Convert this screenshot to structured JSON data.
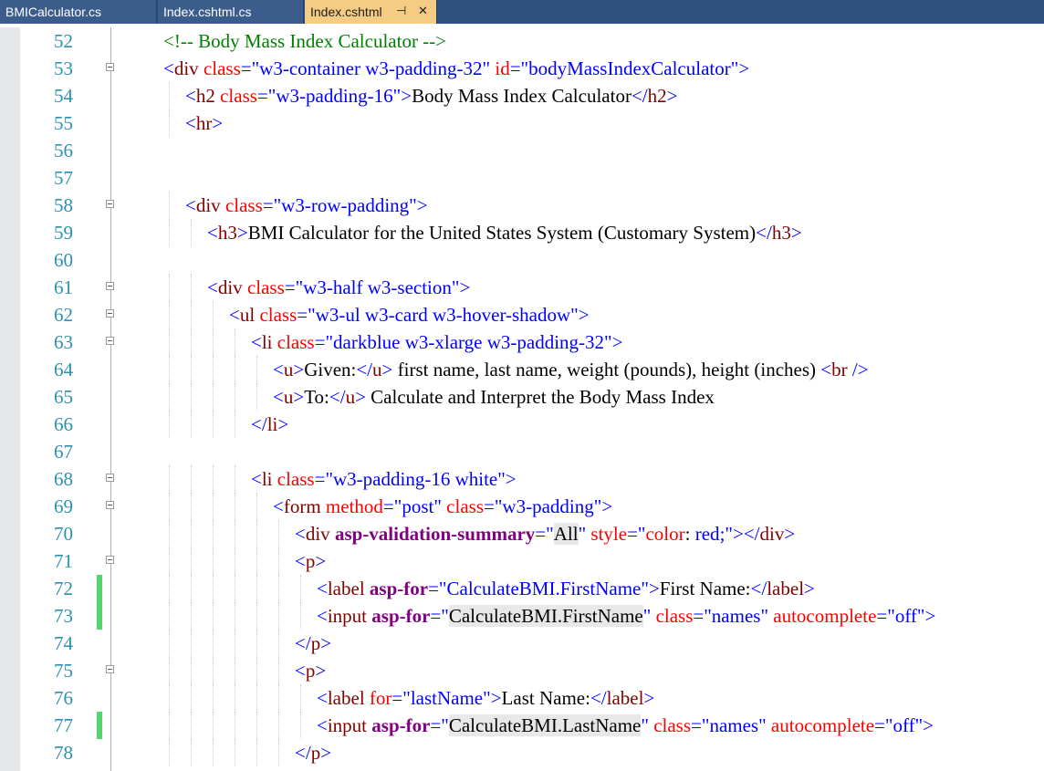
{
  "tabs": [
    {
      "label": "BMICalculator.cs",
      "active": false
    },
    {
      "label": "Index.cshtml.cs",
      "active": false
    },
    {
      "label": "Index.cshtml",
      "active": true
    }
  ],
  "tab_icons": {
    "pin": "pin-icon",
    "close": "close-icon"
  },
  "colors": {
    "tab_bar": "#2f4f7f",
    "active_tab": "#f5cc84",
    "line_number": "#2b91af",
    "change_marker": "#57d36f"
  },
  "lines": [
    {
      "num": "52",
      "fold": false,
      "changed": false,
      "indent": 0,
      "segments": [
        {
          "t": "<!-- Body Mass Index Calculator -->",
          "c": "c"
        }
      ]
    },
    {
      "num": "53",
      "fold": true,
      "changed": false,
      "indent": 0,
      "segments": [
        {
          "t": "<",
          "c": "b"
        },
        {
          "t": "div",
          "c": "t"
        },
        {
          "t": " "
        },
        {
          "t": "class",
          "c": "a"
        },
        {
          "t": "=",
          "c": "b"
        },
        {
          "t": "\"w3-container w3-padding-32\"",
          "c": "v"
        },
        {
          "t": " "
        },
        {
          "t": "id",
          "c": "a"
        },
        {
          "t": "=",
          "c": "b"
        },
        {
          "t": "\"bodyMassIndexCalculator\"",
          "c": "v"
        },
        {
          "t": ">",
          "c": "b"
        }
      ]
    },
    {
      "num": "54",
      "fold": false,
      "changed": false,
      "indent": 1,
      "segments": [
        {
          "t": "<",
          "c": "b"
        },
        {
          "t": "h2",
          "c": "t"
        },
        {
          "t": " "
        },
        {
          "t": "class",
          "c": "a"
        },
        {
          "t": "=",
          "c": "b"
        },
        {
          "t": "\"w3-padding-16\"",
          "c": "v"
        },
        {
          "t": ">",
          "c": "b"
        },
        {
          "t": "Body Mass Index Calculator"
        },
        {
          "t": "</",
          "c": "b"
        },
        {
          "t": "h2",
          "c": "t"
        },
        {
          "t": ">",
          "c": "b"
        }
      ]
    },
    {
      "num": "55",
      "fold": false,
      "changed": false,
      "indent": 1,
      "segments": [
        {
          "t": "<",
          "c": "b"
        },
        {
          "t": "hr",
          "c": "t"
        },
        {
          "t": ">",
          "c": "b"
        }
      ]
    },
    {
      "num": "56",
      "fold": false,
      "changed": false,
      "indent": 0,
      "segments": []
    },
    {
      "num": "57",
      "fold": false,
      "changed": false,
      "indent": 0,
      "segments": []
    },
    {
      "num": "58",
      "fold": true,
      "changed": false,
      "indent": 1,
      "segments": [
        {
          "t": "<",
          "c": "b"
        },
        {
          "t": "div",
          "c": "t"
        },
        {
          "t": " "
        },
        {
          "t": "class",
          "c": "a"
        },
        {
          "t": "=",
          "c": "b"
        },
        {
          "t": "\"w3-row-padding\"",
          "c": "v"
        },
        {
          "t": ">",
          "c": "b"
        }
      ]
    },
    {
      "num": "59",
      "fold": false,
      "changed": false,
      "indent": 2,
      "segments": [
        {
          "t": "<",
          "c": "b"
        },
        {
          "t": "h3",
          "c": "t"
        },
        {
          "t": ">",
          "c": "b"
        },
        {
          "t": "BMI Calculator for the United States System (Customary System)"
        },
        {
          "t": "</",
          "c": "b"
        },
        {
          "t": "h3",
          "c": "t"
        },
        {
          "t": ">",
          "c": "b"
        }
      ]
    },
    {
      "num": "60",
      "fold": false,
      "changed": false,
      "indent": 0,
      "segments": []
    },
    {
      "num": "61",
      "fold": true,
      "changed": false,
      "indent": 2,
      "segments": [
        {
          "t": "<",
          "c": "b"
        },
        {
          "t": "div",
          "c": "t"
        },
        {
          "t": " "
        },
        {
          "t": "class",
          "c": "a"
        },
        {
          "t": "=",
          "c": "b"
        },
        {
          "t": "\"w3-half w3-section\"",
          "c": "v"
        },
        {
          "t": ">",
          "c": "b"
        }
      ]
    },
    {
      "num": "62",
      "fold": true,
      "changed": false,
      "indent": 3,
      "segments": [
        {
          "t": "<",
          "c": "b"
        },
        {
          "t": "ul",
          "c": "t"
        },
        {
          "t": " "
        },
        {
          "t": "class",
          "c": "a"
        },
        {
          "t": "=",
          "c": "b"
        },
        {
          "t": "\"w3-ul w3-card w3-hover-shadow\"",
          "c": "v"
        },
        {
          "t": ">",
          "c": "b"
        }
      ]
    },
    {
      "num": "63",
      "fold": true,
      "changed": false,
      "indent": 4,
      "segments": [
        {
          "t": "<",
          "c": "b"
        },
        {
          "t": "li",
          "c": "t"
        },
        {
          "t": " "
        },
        {
          "t": "class",
          "c": "a"
        },
        {
          "t": "=",
          "c": "b"
        },
        {
          "t": "\"darkblue w3-xlarge w3-padding-32\"",
          "c": "v"
        },
        {
          "t": ">",
          "c": "b"
        }
      ]
    },
    {
      "num": "64",
      "fold": false,
      "changed": false,
      "indent": 5,
      "segments": [
        {
          "t": "<",
          "c": "b"
        },
        {
          "t": "u",
          "c": "t"
        },
        {
          "t": ">",
          "c": "b"
        },
        {
          "t": "Given:"
        },
        {
          "t": "</",
          "c": "b"
        },
        {
          "t": "u",
          "c": "t"
        },
        {
          "t": ">",
          "c": "b"
        },
        {
          "t": " first name, last name, weight (pounds), height (inches) "
        },
        {
          "t": "<",
          "c": "b"
        },
        {
          "t": "br",
          "c": "t"
        },
        {
          "t": " />",
          "c": "b"
        }
      ]
    },
    {
      "num": "65",
      "fold": false,
      "changed": false,
      "indent": 5,
      "segments": [
        {
          "t": "<",
          "c": "b"
        },
        {
          "t": "u",
          "c": "t"
        },
        {
          "t": ">",
          "c": "b"
        },
        {
          "t": "To:"
        },
        {
          "t": "</",
          "c": "b"
        },
        {
          "t": "u",
          "c": "t"
        },
        {
          "t": ">",
          "c": "b"
        },
        {
          "t": " Calculate and Interpret the Body Mass Index"
        }
      ]
    },
    {
      "num": "66",
      "fold": false,
      "changed": false,
      "indent": 4,
      "segments": [
        {
          "t": "</",
          "c": "b"
        },
        {
          "t": "li",
          "c": "t"
        },
        {
          "t": ">",
          "c": "b"
        }
      ]
    },
    {
      "num": "67",
      "fold": false,
      "changed": false,
      "indent": 0,
      "segments": []
    },
    {
      "num": "68",
      "fold": true,
      "changed": false,
      "indent": 4,
      "segments": [
        {
          "t": "<",
          "c": "b"
        },
        {
          "t": "li",
          "c": "t"
        },
        {
          "t": " "
        },
        {
          "t": "class",
          "c": "a"
        },
        {
          "t": "=",
          "c": "b"
        },
        {
          "t": "\"w3-padding-16 white\"",
          "c": "v"
        },
        {
          "t": ">",
          "c": "b"
        }
      ]
    },
    {
      "num": "69",
      "fold": true,
      "changed": false,
      "indent": 5,
      "segments": [
        {
          "t": "<",
          "c": "b"
        },
        {
          "t": "form",
          "c": "t"
        },
        {
          "t": " "
        },
        {
          "t": "method",
          "c": "a"
        },
        {
          "t": "=",
          "c": "b"
        },
        {
          "t": "\"post\"",
          "c": "v"
        },
        {
          "t": " "
        },
        {
          "t": "class",
          "c": "a"
        },
        {
          "t": "=",
          "c": "b"
        },
        {
          "t": "\"w3-padding\"",
          "c": "v"
        },
        {
          "t": ">",
          "c": "b"
        }
      ]
    },
    {
      "num": "70",
      "fold": false,
      "changed": false,
      "indent": 6,
      "segments": [
        {
          "t": "<",
          "c": "b"
        },
        {
          "t": "div",
          "c": "t"
        },
        {
          "t": " "
        },
        {
          "t": "asp-validation-summary",
          "c": "k"
        },
        {
          "t": "=",
          "c": "b"
        },
        {
          "t": "\"",
          "c": "v"
        },
        {
          "t": "All",
          "c": "hl"
        },
        {
          "t": "\"",
          "c": "v"
        },
        {
          "t": " "
        },
        {
          "t": "style",
          "c": "a"
        },
        {
          "t": "=",
          "c": "b"
        },
        {
          "t": "\"",
          "c": "v"
        },
        {
          "t": "color",
          "c": "a"
        },
        {
          "t": ": "
        },
        {
          "t": "red",
          "c": "v"
        },
        {
          "t": ";\"",
          "c": "v"
        },
        {
          "t": "></",
          "c": "b"
        },
        {
          "t": "div",
          "c": "t"
        },
        {
          "t": ">",
          "c": "b"
        }
      ]
    },
    {
      "num": "71",
      "fold": true,
      "changed": false,
      "indent": 6,
      "segments": [
        {
          "t": "<",
          "c": "b"
        },
        {
          "t": "p",
          "c": "t"
        },
        {
          "t": ">",
          "c": "b"
        }
      ]
    },
    {
      "num": "72",
      "fold": false,
      "changed": true,
      "indent": 7,
      "segments": [
        {
          "t": "<",
          "c": "b"
        },
        {
          "t": "label",
          "c": "t"
        },
        {
          "t": " "
        },
        {
          "t": "asp-for",
          "c": "k"
        },
        {
          "t": "=",
          "c": "b"
        },
        {
          "t": "\"CalculateBMI.FirstName\"",
          "c": "v"
        },
        {
          "t": ">",
          "c": "b"
        },
        {
          "t": "First Name:"
        },
        {
          "t": "</",
          "c": "b"
        },
        {
          "t": "label",
          "c": "t"
        },
        {
          "t": ">",
          "c": "b"
        }
      ]
    },
    {
      "num": "73",
      "fold": false,
      "changed": true,
      "indent": 7,
      "segments": [
        {
          "t": "<",
          "c": "b"
        },
        {
          "t": "input",
          "c": "t"
        },
        {
          "t": " "
        },
        {
          "t": "asp-for",
          "c": "k"
        },
        {
          "t": "=",
          "c": "b"
        },
        {
          "t": "\"",
          "c": "v"
        },
        {
          "t": "CalculateBMI.FirstName",
          "c": "hl"
        },
        {
          "t": "\"",
          "c": "v"
        },
        {
          "t": " "
        },
        {
          "t": "class",
          "c": "a"
        },
        {
          "t": "=",
          "c": "b"
        },
        {
          "t": "\"names\"",
          "c": "v"
        },
        {
          "t": " "
        },
        {
          "t": "autocomplete",
          "c": "a"
        },
        {
          "t": "=",
          "c": "b"
        },
        {
          "t": "\"off\"",
          "c": "v"
        },
        {
          "t": ">",
          "c": "b"
        }
      ]
    },
    {
      "num": "74",
      "fold": false,
      "changed": false,
      "indent": 6,
      "segments": [
        {
          "t": "</",
          "c": "b"
        },
        {
          "t": "p",
          "c": "t"
        },
        {
          "t": ">",
          "c": "b"
        }
      ]
    },
    {
      "num": "75",
      "fold": true,
      "changed": false,
      "indent": 6,
      "segments": [
        {
          "t": "<",
          "c": "b"
        },
        {
          "t": "p",
          "c": "t"
        },
        {
          "t": ">",
          "c": "b"
        }
      ]
    },
    {
      "num": "76",
      "fold": false,
      "changed": false,
      "indent": 7,
      "segments": [
        {
          "t": "<",
          "c": "b"
        },
        {
          "t": "label",
          "c": "t"
        },
        {
          "t": " "
        },
        {
          "t": "for",
          "c": "a"
        },
        {
          "t": "=",
          "c": "b"
        },
        {
          "t": "\"lastName\"",
          "c": "v"
        },
        {
          "t": ">",
          "c": "b"
        },
        {
          "t": "Last Name:"
        },
        {
          "t": "</",
          "c": "b"
        },
        {
          "t": "label",
          "c": "t"
        },
        {
          "t": ">",
          "c": "b"
        }
      ]
    },
    {
      "num": "77",
      "fold": false,
      "changed": true,
      "indent": 7,
      "segments": [
        {
          "t": "<",
          "c": "b"
        },
        {
          "t": "input",
          "c": "t"
        },
        {
          "t": " "
        },
        {
          "t": "asp-for",
          "c": "k"
        },
        {
          "t": "=",
          "c": "b"
        },
        {
          "t": "\"",
          "c": "v"
        },
        {
          "t": "CalculateBMI.LastName",
          "c": "hl"
        },
        {
          "t": "\"",
          "c": "v"
        },
        {
          "t": " "
        },
        {
          "t": "class",
          "c": "a"
        },
        {
          "t": "=",
          "c": "b"
        },
        {
          "t": "\"names\"",
          "c": "v"
        },
        {
          "t": " "
        },
        {
          "t": "autocomplete",
          "c": "a"
        },
        {
          "t": "=",
          "c": "b"
        },
        {
          "t": "\"off\"",
          "c": "v"
        },
        {
          "t": ">",
          "c": "b"
        }
      ]
    },
    {
      "num": "78",
      "fold": false,
      "changed": false,
      "indent": 6,
      "segments": [
        {
          "t": "</",
          "c": "b"
        },
        {
          "t": "p",
          "c": "t"
        },
        {
          "t": ">",
          "c": "b"
        }
      ]
    }
  ]
}
